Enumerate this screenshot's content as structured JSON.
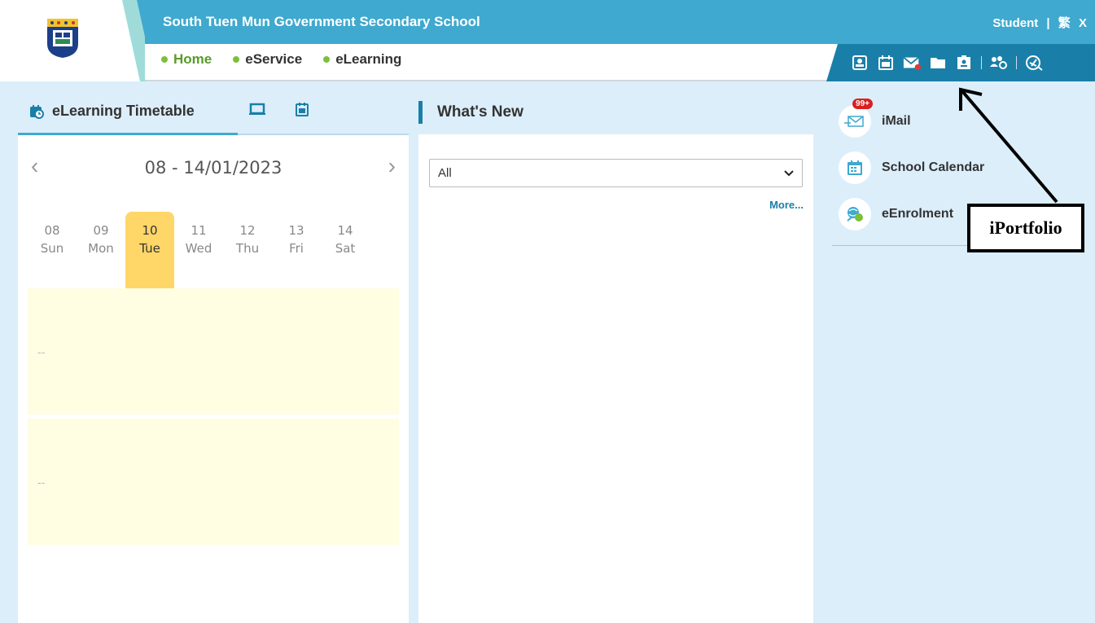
{
  "header": {
    "school_name": "South Tuen Mun Government Secondary School",
    "user_role": "Student",
    "separator": "|",
    "lang_toggle": "繁",
    "logout": "X"
  },
  "nav": {
    "items": [
      "Home",
      "eService",
      "eLearning"
    ]
  },
  "toolbar_icons": [
    "account-icon",
    "calendar-icon",
    "mail-icon",
    "folder-icon",
    "portfolio-icon",
    "group-settings-icon",
    "tools-icon"
  ],
  "timetable": {
    "tab_label": "eLearning Timetable",
    "prev": "‹",
    "next": "›",
    "date_range": "08 - 14/01/2023",
    "days": [
      {
        "num": "08",
        "name": "Sun"
      },
      {
        "num": "09",
        "name": "Mon"
      },
      {
        "num": "10",
        "name": "Tue"
      },
      {
        "num": "11",
        "name": "Wed"
      },
      {
        "num": "12",
        "name": "Thu"
      },
      {
        "num": "13",
        "name": "Fri"
      },
      {
        "num": "14",
        "name": "Sat"
      }
    ],
    "active_day": "10",
    "slot_1": "--",
    "slot_2": "--"
  },
  "whats_new": {
    "title": "What's New",
    "filter_value": "All",
    "more": "More..."
  },
  "shortcuts": {
    "imail": "iMail",
    "imail_badge": "99+",
    "calendar": "School Calendar",
    "enrolment": "eEnrolment"
  },
  "annotation": {
    "label": "iPortfolio"
  },
  "colors": {
    "header_blue": "#3fa9cf",
    "toolbar_blue": "#1a7fa8",
    "active_green": "#5a9a2a",
    "day_highlight": "#ffd668",
    "slot_bg": "#fffde2"
  }
}
